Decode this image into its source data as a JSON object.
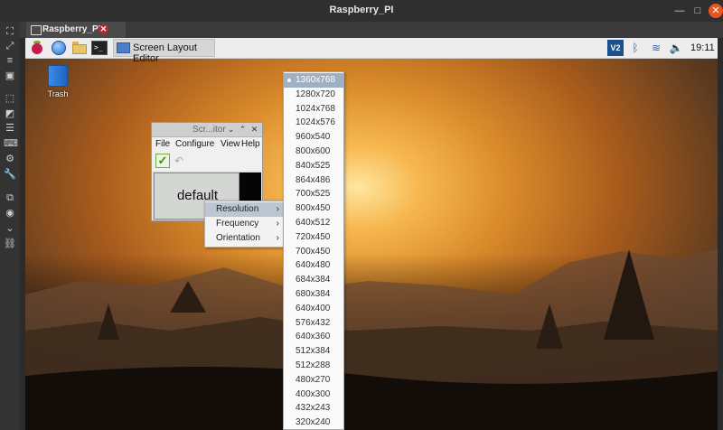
{
  "host": {
    "title": "Raspberry_PI",
    "controls": {
      "minimize": "—",
      "maximize": "□",
      "close": "✕"
    },
    "tab": {
      "label": "Raspberry_PI",
      "close": "✕"
    },
    "toolbar_icons": [
      "fit-screen-icon",
      "fullscreen-icon",
      "list-icon",
      "window-icon",
      "select-icon",
      "screenshot-icon",
      "menu-icon",
      "keyboard-icon",
      "settings-icon",
      "wrench-icon",
      "copy-icon",
      "camera-icon",
      "chevron-down-icon",
      "link-icon"
    ]
  },
  "pi_taskbar": {
    "app_task_label": "Screen Layout Editor",
    "vnc_label": "V2",
    "clock": "19:11"
  },
  "desktop": {
    "trash_label": "Trash"
  },
  "sle_window": {
    "title": "Scr...itor",
    "menus": [
      "File",
      "Configure",
      "View",
      "Help"
    ],
    "monitor_label": "default"
  },
  "context_menu": {
    "items": [
      {
        "label": "Resolution",
        "arrow": "›"
      },
      {
        "label": "Frequency",
        "arrow": "›"
      },
      {
        "label": "Orientation",
        "arrow": "›"
      }
    ]
  },
  "resolution_menu": {
    "selected": "1360x768",
    "items": [
      "1360x768",
      "1280x720",
      "1024x768",
      "1024x576",
      "960x540",
      "800x600",
      "840x525",
      "864x486",
      "700x525",
      "800x450",
      "640x512",
      "720x450",
      "700x450",
      "640x480",
      "684x384",
      "680x384",
      "640x400",
      "576x432",
      "640x360",
      "512x384",
      "512x288",
      "480x270",
      "400x300",
      "432x243",
      "320x240"
    ]
  }
}
